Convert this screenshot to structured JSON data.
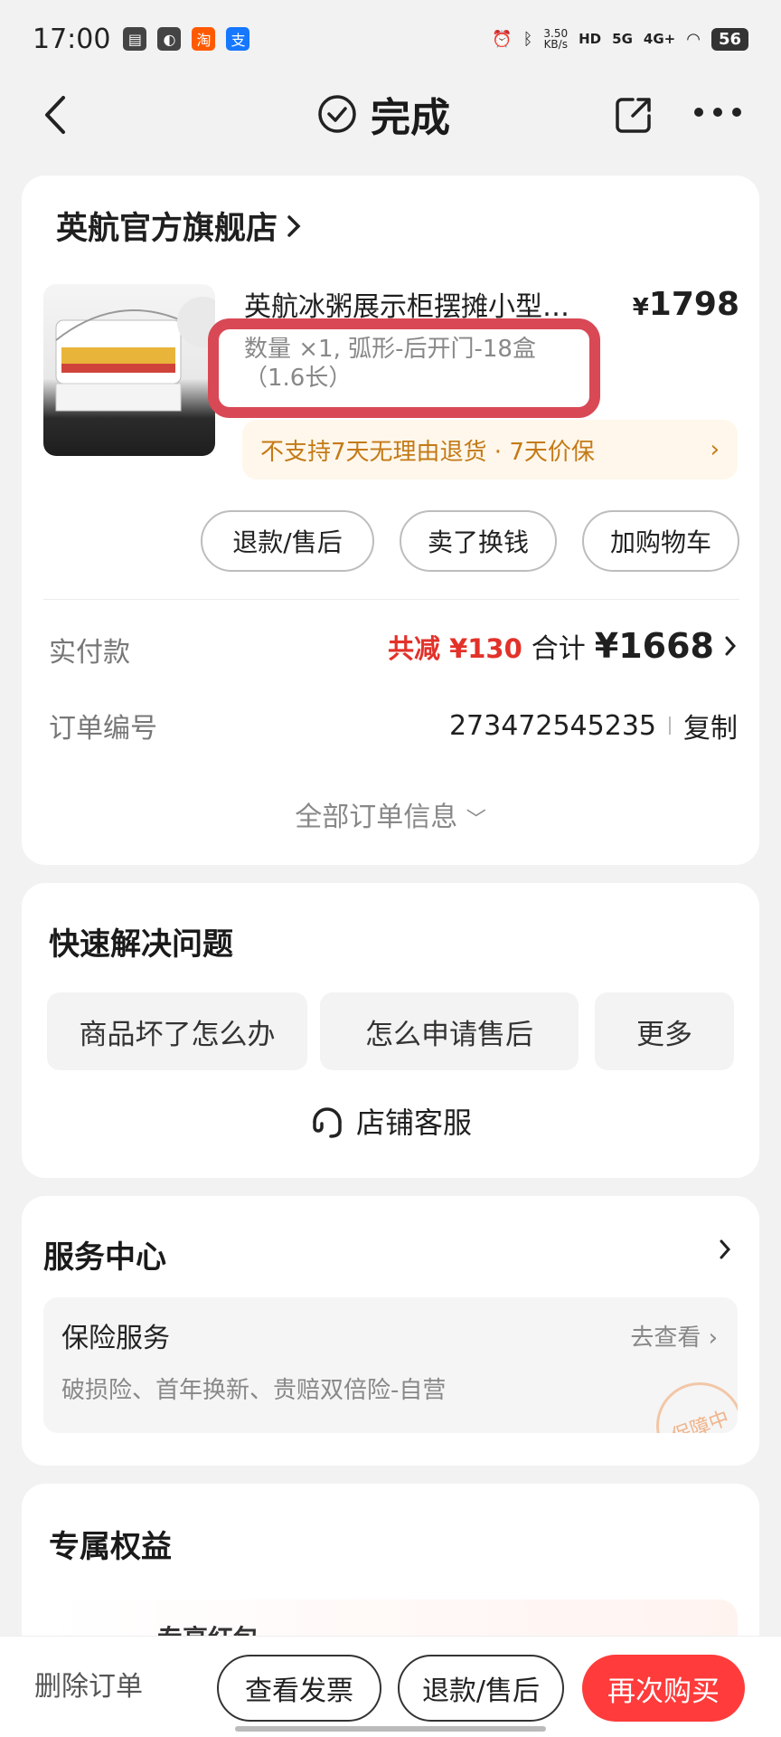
{
  "status_bar": {
    "time": "17:00",
    "net_speed": "3.50",
    "net_speed_unit": "KB/s",
    "signal_1": "5G",
    "signal_2": "4G+",
    "hd_label": "HD",
    "battery": "56"
  },
  "nav": {
    "title": "完成"
  },
  "order": {
    "store_name": "英航官方旗舰店",
    "product_title": "英航冰粥展示柜摆摊小型…",
    "price_symbol": "¥",
    "price": "1798",
    "spec": "数量 ×1, 弧形-后开门-18盒（1.6长）",
    "return_policy": "不支持7天无理由退货 · 7天价保",
    "buttons": [
      "退款/售后",
      "卖了换钱",
      "加购物车"
    ],
    "paid_label": "实付款",
    "discount": "共减 ¥130",
    "total_label": "合计",
    "total_value": "¥1668",
    "order_no_label": "订单编号",
    "order_no": "273472545235",
    "copy_label": "复制",
    "all_info": "全部订单信息"
  },
  "quick_solve": {
    "title": "快速解决问题",
    "chips": [
      "商品坏了怎么办",
      "怎么申请售后",
      "更多"
    ],
    "customer_service": "店铺客服"
  },
  "service_center": {
    "title": "服务中心",
    "insurance_title": "保险服务",
    "insurance_link": "去查看",
    "insurance_desc": "破损险、首年换新、贵赔双倍险-自营",
    "stamp_text": "保障中"
  },
  "benefits": {
    "title": "专属权益",
    "item": "专享红包"
  },
  "bottom_bar": {
    "delete": "删除订单",
    "invoice": "查看发票",
    "refund": "退款/售后",
    "buy_again": "再次购买"
  },
  "colors": {
    "accent_red": "#ff3b3b",
    "discount_red": "#e2322a",
    "highlight_box": "#d84955",
    "return_orange": "#c47a17"
  }
}
